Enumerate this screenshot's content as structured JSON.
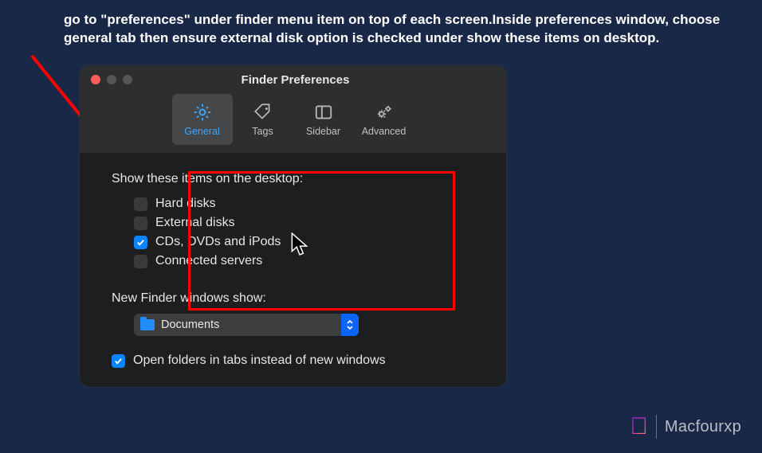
{
  "instruction": "go to \"preferences\" under finder menu item on top of each screen.Inside preferences window, choose general tab then ensure external disk option is checked under show these items on desktop.",
  "window": {
    "title": "Finder Preferences",
    "tabs": [
      {
        "label": "General",
        "icon": "gear-icon",
        "active": true
      },
      {
        "label": "Tags",
        "icon": "tag-icon",
        "active": false
      },
      {
        "label": "Sidebar",
        "icon": "sidebar-icon",
        "active": false
      },
      {
        "label": "Advanced",
        "icon": "gears-icon",
        "active": false
      }
    ]
  },
  "sections": {
    "desktop_heading": "Show these items on the desktop:",
    "desktop_items": [
      {
        "label": "Hard disks",
        "checked": false
      },
      {
        "label": "External disks",
        "checked": false
      },
      {
        "label": "CDs, DVDs and iPods",
        "checked": true
      },
      {
        "label": "Connected servers",
        "checked": false
      }
    ],
    "new_windows_heading": "New Finder windows show:",
    "new_windows_value": "Documents",
    "tabs_checkbox": {
      "label": "Open folders in tabs instead of new windows",
      "checked": true
    }
  },
  "branding": {
    "text": "Macfourxp"
  },
  "colors": {
    "accent": "#0a84ff",
    "highlight": "#ff0000",
    "bg": "#1a2847"
  }
}
